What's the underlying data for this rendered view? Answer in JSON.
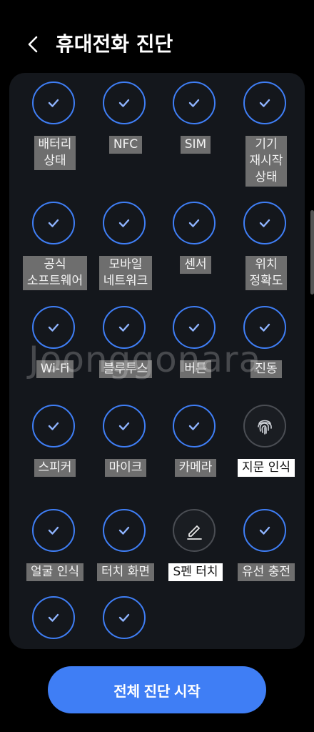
{
  "header": {
    "title": "휴대전화 진단",
    "back_icon": "chevron-left-icon"
  },
  "colors": {
    "accent": "#3f7ef5",
    "panel": "#14171c",
    "label_gray": "#6e6e6e",
    "label_white": "#ffffff"
  },
  "tests": [
    {
      "label": "배터리\n상태",
      "status": "checked",
      "icon": "check-icon",
      "highlight": false
    },
    {
      "label": "NFC",
      "status": "checked",
      "icon": "check-icon",
      "highlight": false
    },
    {
      "label": "SIM",
      "status": "checked",
      "icon": "check-icon",
      "highlight": false
    },
    {
      "label": "기기\n재시작\n상태",
      "status": "checked",
      "icon": "check-icon",
      "highlight": false
    },
    {
      "label": "공식\n소프트웨어",
      "status": "checked",
      "icon": "check-icon",
      "highlight": false
    },
    {
      "label": "모바일\n네트워크",
      "status": "checked",
      "icon": "check-icon",
      "highlight": false
    },
    {
      "label": "센서",
      "status": "checked",
      "icon": "check-icon",
      "highlight": false
    },
    {
      "label": "위치\n정확도",
      "status": "checked",
      "icon": "check-icon",
      "highlight": false
    },
    {
      "label": "Wi-Fi",
      "status": "checked",
      "icon": "check-icon",
      "highlight": false
    },
    {
      "label": "블루투스",
      "status": "checked",
      "icon": "check-icon",
      "highlight": false
    },
    {
      "label": "버튼",
      "status": "checked",
      "icon": "check-icon",
      "highlight": false
    },
    {
      "label": "진동",
      "status": "checked",
      "icon": "check-icon",
      "highlight": false
    },
    {
      "label": "스피커",
      "status": "checked",
      "icon": "check-icon",
      "highlight": false
    },
    {
      "label": "마이크",
      "status": "checked",
      "icon": "check-icon",
      "highlight": false
    },
    {
      "label": "카메라",
      "status": "checked",
      "icon": "check-icon",
      "highlight": false
    },
    {
      "label": "지문 인식",
      "status": "pending",
      "icon": "fingerprint-icon",
      "highlight": true
    },
    {
      "label": "얼굴 인식",
      "status": "checked",
      "icon": "check-icon",
      "highlight": false
    },
    {
      "label": "터치 화면",
      "status": "checked",
      "icon": "check-icon",
      "highlight": false
    },
    {
      "label": "S펜 터치",
      "status": "pending",
      "icon": "pen-icon",
      "highlight": true
    },
    {
      "label": "유선 충전",
      "status": "checked",
      "icon": "check-icon",
      "highlight": false
    },
    {
      "label": "",
      "status": "checked",
      "icon": "check-icon",
      "highlight": false
    },
    {
      "label": "",
      "status": "checked",
      "icon": "check-icon",
      "highlight": false
    }
  ],
  "watermark": "Joonggonara",
  "start_button": {
    "label": "전체 진단 시작"
  }
}
